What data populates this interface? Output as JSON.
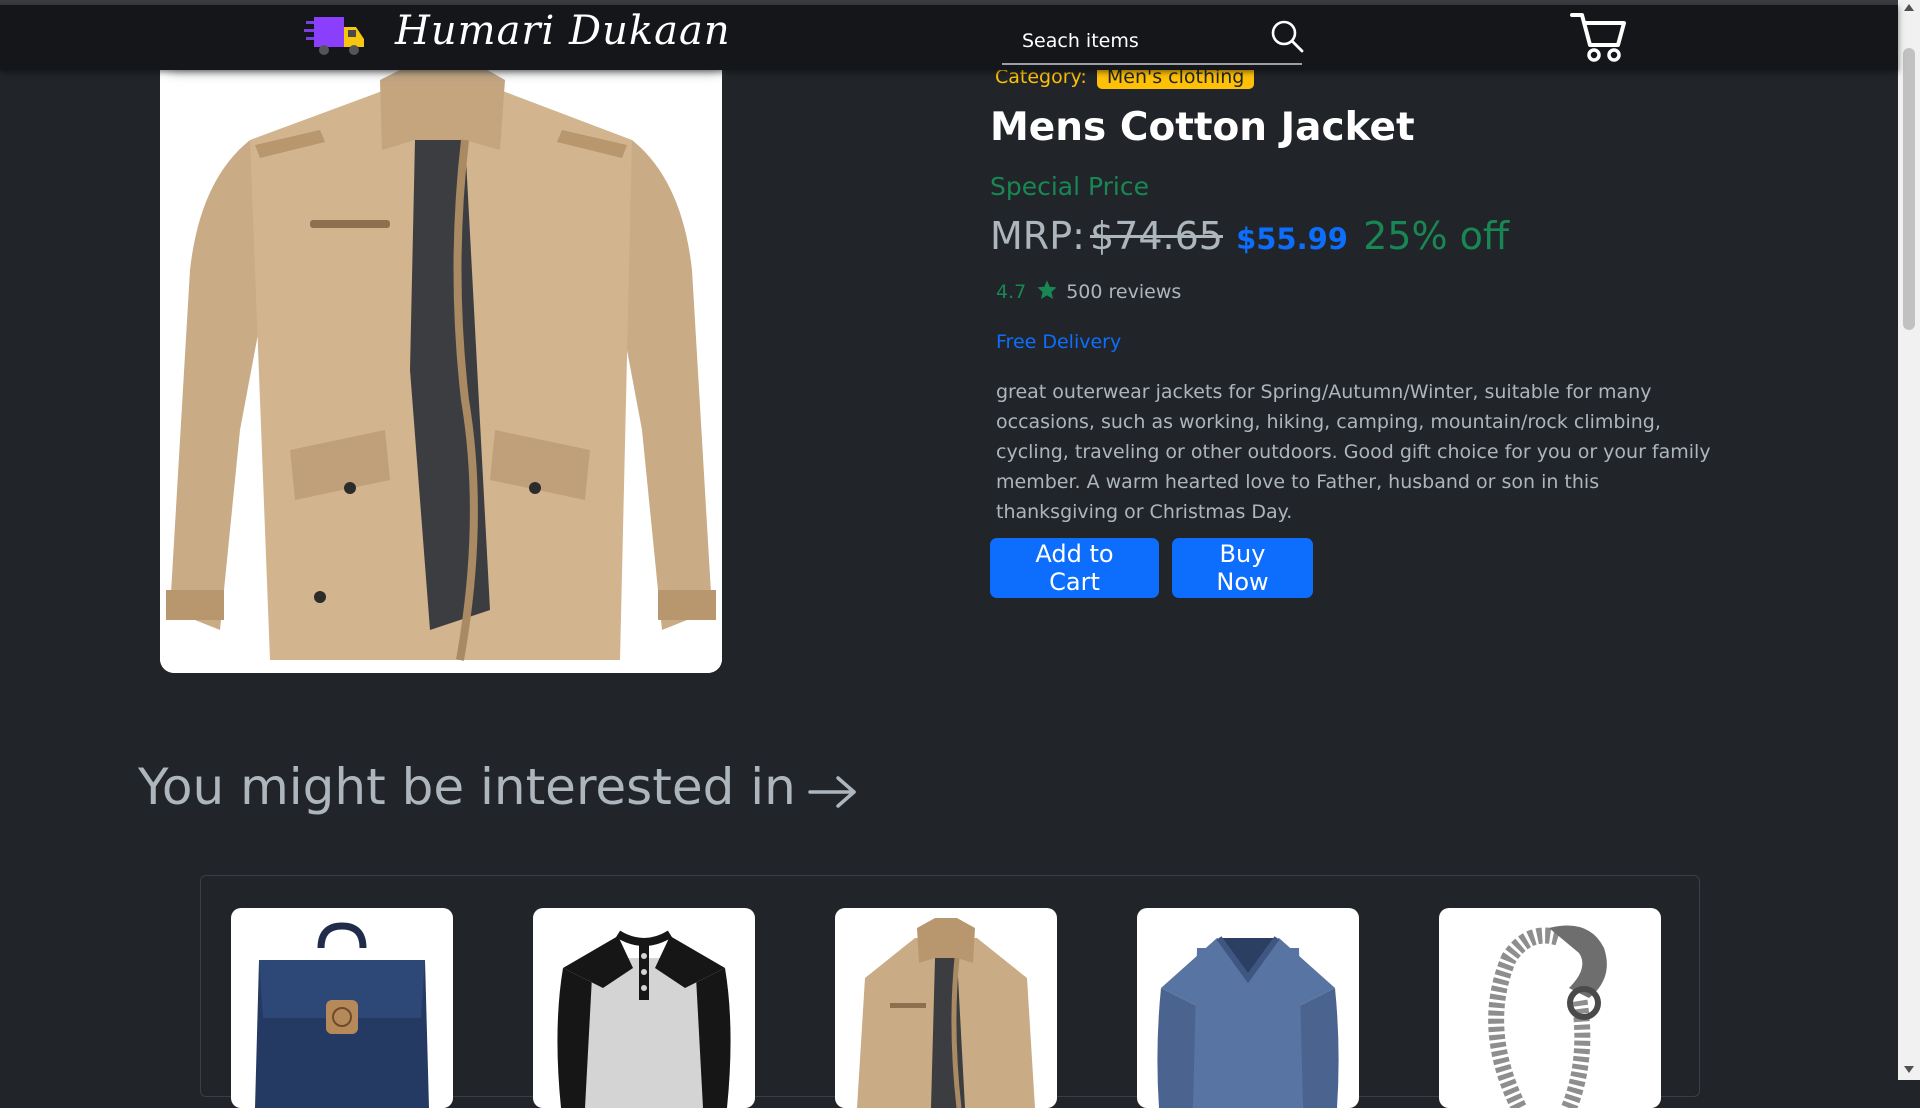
{
  "brand": {
    "name": "Humari Dukaan"
  },
  "search": {
    "placeholder": "Seach items"
  },
  "product": {
    "category_label": "Category:",
    "category": "Men's clothing",
    "title": "Mens Cotton Jacket",
    "special_price_label": "Special Price",
    "mrp_label": "MRP:",
    "mrp": "$74.65",
    "price": "$55.99",
    "discount": "25% off",
    "rating": "4.7",
    "reviews": "500 reviews",
    "delivery": "Free Delivery",
    "description": "great outerwear jackets for Spring/Autumn/Winter, suitable for many occasions, such as working, hiking, camping, mountain/rock climbing, cycling, traveling or other outdoors. Good gift choice for you or your family member. A warm hearted love to Father, husband or son in this thanksgiving or Christmas Day."
  },
  "actions": {
    "add_to_cart": "Add to Cart",
    "buy_now": "Buy Now"
  },
  "recommendations": {
    "heading": "You might be interested in",
    "items": [
      "backpack",
      "raglan-henley-shirt",
      "cotton-jacket",
      "v-neck-sweater",
      "dragon-bracelet"
    ]
  },
  "colors": {
    "background": "#212529",
    "navbar": "#141619",
    "primary": "#0d6efd",
    "success": "#198754",
    "warning": "#ffc107",
    "muted": "#adb5bd"
  },
  "icons": [
    "truck-icon",
    "search-icon",
    "cart-icon",
    "star-icon",
    "arrow-right-icon"
  ]
}
